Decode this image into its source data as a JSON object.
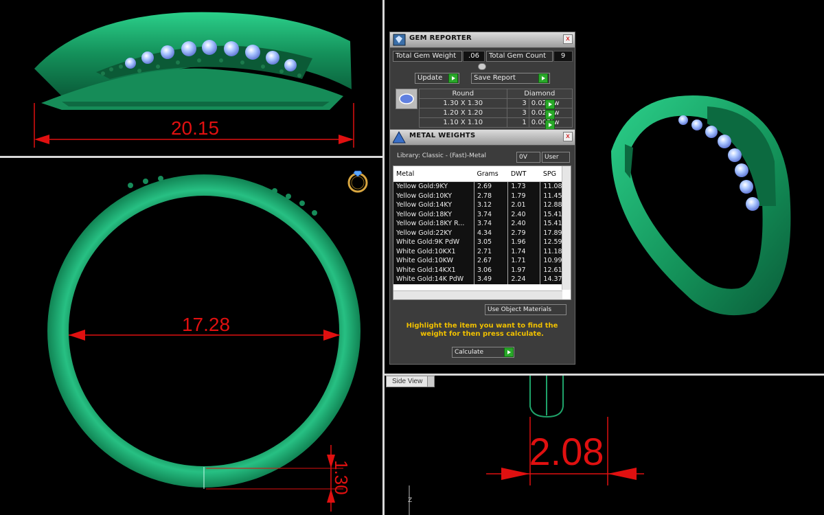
{
  "viewports": {
    "top": {
      "dimension": "20.15"
    },
    "front": {
      "dimension_main": "17.28",
      "dimension_band": "1.30"
    },
    "side": {
      "dimension": "2.08",
      "view_label": "Side View",
      "axis_label": "Z"
    }
  },
  "gem_reporter": {
    "title": "GEM REPORTER",
    "close": "x",
    "total_weight_label": "Total Gem Weight",
    "total_weight_value": ".06",
    "total_count_label": "Total Gem Count",
    "total_count_value": "9",
    "update_label": "Update",
    "save_report_label": "Save Report",
    "table_headers": [
      "Round",
      "Diamond"
    ],
    "rows": [
      {
        "size": "1.30 X 1.30",
        "count": "3",
        "weight": "0.025tw"
      },
      {
        "size": "1.20 X 1.20",
        "count": "3",
        "weight": "0.020tw"
      },
      {
        "size": "1.10 X 1.10",
        "count": "1",
        "weight": "0.005tw"
      }
    ]
  },
  "metal_weights": {
    "title": "METAL WEIGHTS",
    "close": "x",
    "library": "Library: Classic - (Fast)-Metal",
    "toggle_left": "0V",
    "toggle_right": "User",
    "columns": [
      "Metal",
      "Grams",
      "DWT",
      "SPG"
    ],
    "rows": [
      [
        "Yellow Gold:9KY",
        "2.69",
        "1.73",
        "11.08"
      ],
      [
        "Yellow Gold:10KY",
        "2.78",
        "1.79",
        "11.45"
      ],
      [
        "Yellow Gold:14KY",
        "3.12",
        "2.01",
        "12.88"
      ],
      [
        "Yellow Gold:18KY",
        "3.74",
        "2.40",
        "15.41"
      ],
      [
        "Yellow Gold:18KY R...",
        "3.74",
        "2.40",
        "15.41"
      ],
      [
        "Yellow Gold:22KY",
        "4.34",
        "2.79",
        "17.89"
      ],
      [
        "White Gold:9K PdW",
        "3.05",
        "1.96",
        "12.59"
      ],
      [
        "White Gold:10KX1",
        "2.71",
        "1.74",
        "11.18"
      ],
      [
        "White Gold:10KW",
        "2.67",
        "1.71",
        "10.99"
      ],
      [
        "White Gold:14KX1",
        "3.06",
        "1.97",
        "12.61"
      ],
      [
        "White Gold:14K PdW",
        "3.49",
        "2.24",
        "14.37"
      ]
    ],
    "use_object_materials": "Use Object Materials",
    "instruction": "Highlight the item you want to find the weight for then press calculate.",
    "calculate_label": "Calculate"
  },
  "colors": {
    "ring_green": "#1fa36a",
    "dimension_red": "#e01010",
    "gem_blue": "#8fb0ff",
    "instruction_yellow": "#f0c000"
  }
}
